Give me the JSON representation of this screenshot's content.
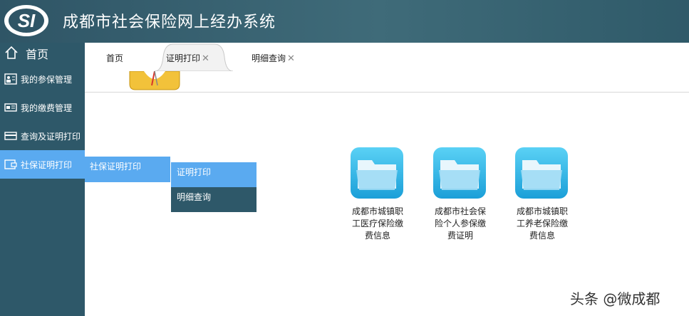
{
  "header": {
    "title": "成都市社会保险网上经办系统",
    "logo_icon": "si-logo-icon",
    "logo_text": "SI"
  },
  "sidebar": {
    "home_label": "首页",
    "items": [
      {
        "label": "我的参保管理",
        "icon": "id-card-icon"
      },
      {
        "label": "我的缴费管理",
        "icon": "payment-card-icon"
      },
      {
        "label": "查询及证明打印",
        "icon": "credit-card-icon"
      },
      {
        "label": "社保证明打印",
        "icon": "wallet-icon",
        "active": true
      }
    ]
  },
  "flyout": {
    "level1_label": "社保证明打印",
    "level2": [
      {
        "label": "证明打印",
        "active": true
      },
      {
        "label": "明细查询"
      }
    ]
  },
  "tabs": [
    {
      "label": "首页",
      "closable": false
    },
    {
      "label": "证明打印",
      "closable": true,
      "active": true
    },
    {
      "label": "明细查询",
      "closable": true
    }
  ],
  "tab_close_glyph": "✕",
  "folders": [
    {
      "label": "成都市城镇职工医疗保险缴费信息",
      "lines": [
        "成都市城镇职",
        "工医疗保险缴",
        "费信息"
      ]
    },
    {
      "label": "成都市社会保险个人参保缴费证明",
      "lines": [
        "成都市社会保",
        "险个人参保缴",
        "费证明"
      ]
    },
    {
      "label": "成都市城镇职工养老保险缴费信息",
      "lines": [
        "成都市城镇职",
        "工养老保险缴",
        "费信息"
      ]
    }
  ],
  "watermark": "头条 @微成都",
  "colors": {
    "header": "#3f6b79",
    "sidebar": "#2e5869",
    "accent": "#5aaaf0"
  }
}
